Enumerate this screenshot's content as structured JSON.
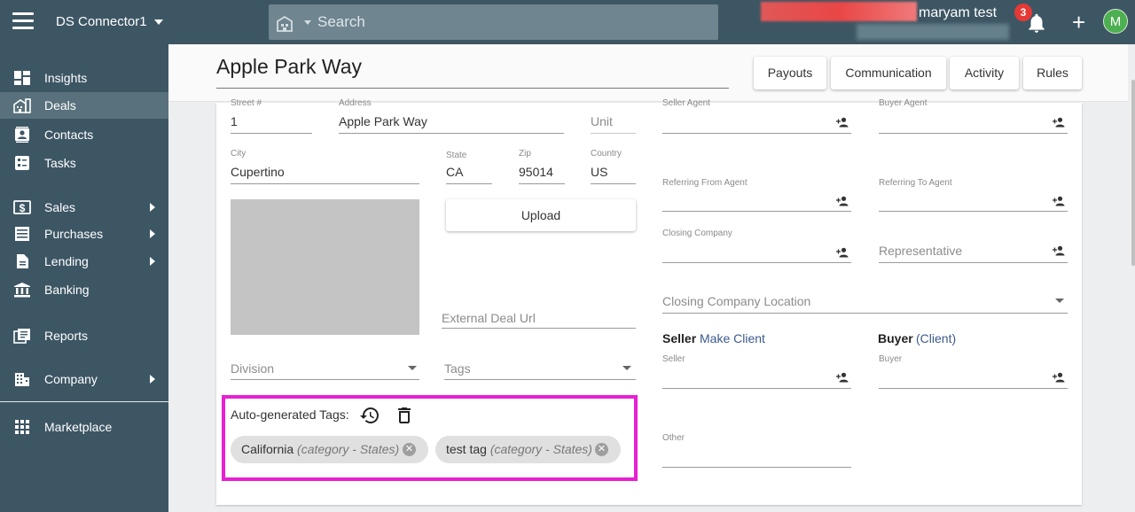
{
  "topbar": {
    "org_name": "DS Connector1",
    "search_placeholder": "Search",
    "username": "maryam test",
    "notification_count": "3",
    "add_label": "+",
    "avatar_initial": "M"
  },
  "sidebar": {
    "items": [
      {
        "label": "Insights",
        "icon": "dashboard-icon"
      },
      {
        "label": "Deals",
        "icon": "deals-building-icon"
      },
      {
        "label": "Contacts",
        "icon": "contacts-icon"
      },
      {
        "label": "Tasks",
        "icon": "tasks-icon"
      },
      {
        "label": "Sales",
        "icon": "sales-dollar-icon"
      },
      {
        "label": "Purchases",
        "icon": "purchases-list-icon"
      },
      {
        "label": "Lending",
        "icon": "lending-document-icon"
      },
      {
        "label": "Banking",
        "icon": "bank-icon"
      },
      {
        "label": "Reports",
        "icon": "reports-icon"
      },
      {
        "label": "Company",
        "icon": "company-building-icon"
      },
      {
        "label": "Marketplace",
        "icon": "apps-grid-icon"
      }
    ]
  },
  "page": {
    "title": "Apple Park Way",
    "tabs": [
      "Payouts",
      "Communication",
      "Activity",
      "Rules"
    ]
  },
  "form": {
    "street_label": "Street #",
    "street_value": "1",
    "address_label": "Address",
    "address_value": "Apple Park Way",
    "unit_placeholder": "Unit",
    "city_label": "City",
    "city_value": "Cupertino",
    "state_label": "State",
    "state_value": "CA",
    "zip_label": "Zip",
    "zip_value": "95014",
    "country_label": "Country",
    "country_value": "US",
    "upload_label": "Upload",
    "external_url_placeholder": "External Deal Url",
    "division_placeholder": "Division",
    "tags_placeholder": "Tags",
    "seller_agent_label": "Seller Agent",
    "buyer_agent_label": "Buyer Agent",
    "referring_from_label": "Referring From Agent",
    "referring_to_label": "Referring To Agent",
    "closing_company_label": "Closing Company",
    "representative_placeholder": "Representative",
    "closing_location_placeholder": "Closing Company Location",
    "seller_title": "Seller",
    "make_client_link": "Make Client",
    "buyer_title": "Buyer",
    "buyer_client_link": "(Client)",
    "seller_label": "Seller",
    "buyer_label": "Buyer",
    "other_label": "Other"
  },
  "auto_tags": {
    "label": "Auto-generated Tags:",
    "chips": [
      {
        "name": "California",
        "category": "(category - States)"
      },
      {
        "name": "test tag",
        "category": "(category - States)"
      }
    ]
  }
}
